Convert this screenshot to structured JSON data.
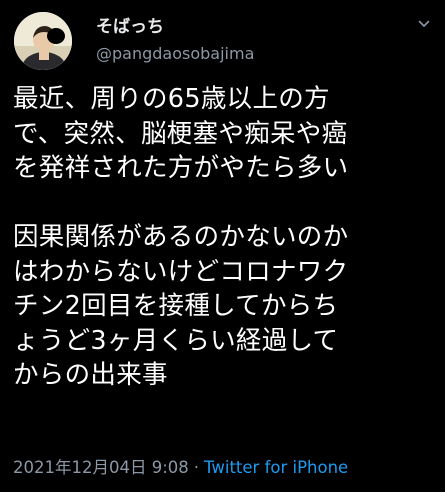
{
  "tweet": {
    "author": {
      "display_name": "そばっち",
      "handle": "@pangdaosobajima"
    },
    "text_lines": [
      "最近、周りの65歳以上の方",
      "で、突然、脳梗塞や痴呆や癌",
      "を発祥された方がやたら多い",
      "",
      "因果関係があるのかないのか",
      "はわからないけどコロナワク",
      "チン2回目を接種してからち",
      "ょうど3ヶ月くらい経過して",
      "からの出来事"
    ],
    "timestamp": "2021年12月04日 9:08",
    "separator": "·",
    "source": "Twitter for iPhone"
  },
  "icons": {
    "avatar": "user-avatar-photo",
    "menu": "chevron-down-icon"
  },
  "colors": {
    "background": "#000000",
    "text": "#ffffff",
    "secondary": "#8b98a5",
    "link": "#1d9bf0"
  }
}
